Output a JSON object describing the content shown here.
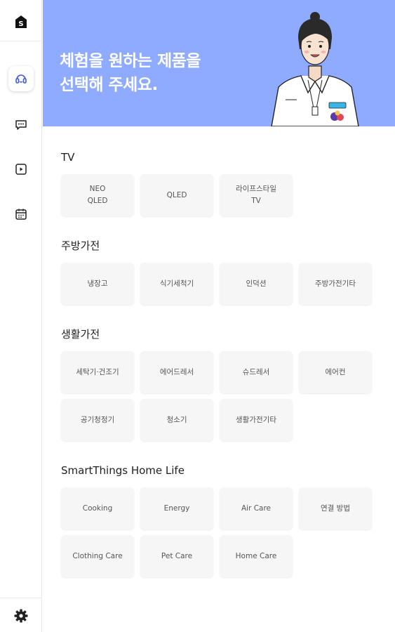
{
  "banner": {
    "title": "체험을 원하는 제품을\n선택해 주세요.",
    "color": "#8fabff"
  },
  "sidebar": {
    "logo_letter": "S",
    "items": [
      {
        "icon": "headset-icon",
        "active": true
      },
      {
        "icon": "chat-icon",
        "active": false
      },
      {
        "icon": "play-icon",
        "active": false
      },
      {
        "icon": "calendar-icon",
        "active": false
      }
    ],
    "settings_icon": "gear-icon"
  },
  "sections": [
    {
      "title": "TV",
      "items": [
        "NEO\nQLED",
        "QLED",
        "라이프스타일\nTV"
      ]
    },
    {
      "title": "주방가전",
      "items": [
        "냉장고",
        "식기세척기",
        "인덕션",
        "주방가전기타"
      ]
    },
    {
      "title": "생활가전",
      "items": [
        "세탁기·건조기",
        "에어드레서",
        "슈드레서",
        "에어컨",
        "공기청정기",
        "청소기",
        "생활가전기타"
      ]
    },
    {
      "title": "SmartThings Home Life",
      "items": [
        "Cooking",
        "Energy",
        "Air Care",
        "연결 방법",
        "Clothing Care",
        "Pet Care",
        "Home Care"
      ]
    }
  ]
}
